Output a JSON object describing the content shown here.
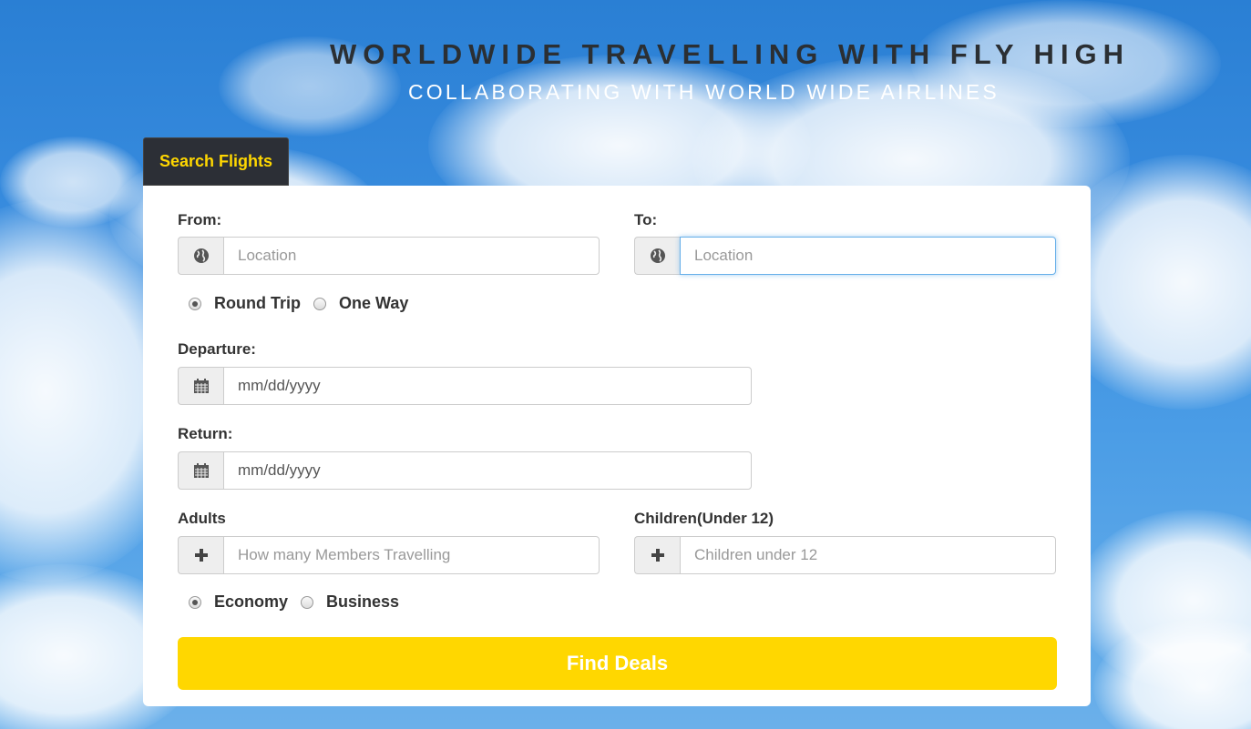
{
  "header": {
    "title": "WORLDWIDE TRAVELLING WITH FLY HIGH",
    "subtitle": "COLLABORATING WITH WORLD WIDE AIRLINES"
  },
  "tabs": [
    {
      "label": "Search Flights",
      "active": true
    }
  ],
  "form": {
    "from": {
      "label": "From:",
      "placeholder": "Location",
      "icon": "globe-icon"
    },
    "to": {
      "label": "To:",
      "placeholder": "Location",
      "icon": "globe-icon",
      "focused": true
    },
    "trip_type": {
      "options": [
        "Round Trip",
        "One Way"
      ],
      "selected": "Round Trip"
    },
    "departure": {
      "label": "Departure:",
      "placeholder": "mm/dd/yyyy",
      "icon": "calendar-icon"
    },
    "return": {
      "label": "Return:",
      "placeholder": "mm/dd/yyyy",
      "icon": "calendar-icon"
    },
    "adults": {
      "label": "Adults",
      "placeholder": "How many Members Travelling",
      "icon": "plus-icon"
    },
    "children": {
      "label": "Children(Under 12)",
      "placeholder": "Children under 12",
      "icon": "plus-icon"
    },
    "cabin_class": {
      "options": [
        "Economy",
        "Business"
      ],
      "selected": "Economy"
    },
    "submit_label": "Find Deals"
  },
  "colors": {
    "accent": "#ffd700",
    "tab_bg": "#2c2f36",
    "title_text": "#2b2f33"
  }
}
